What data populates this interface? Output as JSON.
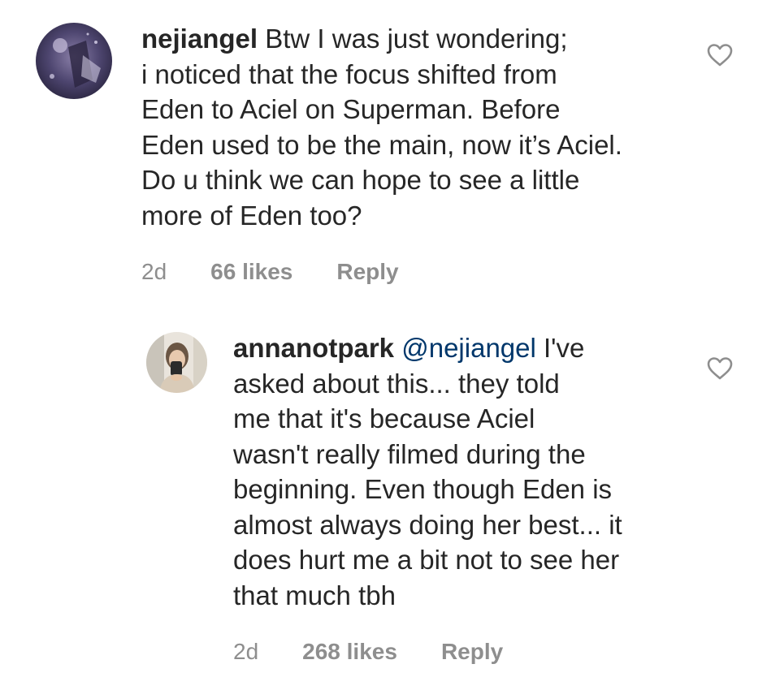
{
  "comments": [
    {
      "username": "nejiangel",
      "mention": "",
      "text_lines": [
        "Btw I was just wondering;",
        "i noticed that the focus shifted from",
        "Eden to Aciel on Superman. Before",
        "Eden used to be the main, now it’s Aciel.",
        "Do u think we can hope to see a little",
        "more of Eden too?"
      ],
      "time": "2d",
      "likes": "66 likes",
      "reply_label": "Reply",
      "like_icon": "heart-outline-icon"
    },
    {
      "username": "annanotpark",
      "mention": "@nejiangel",
      "text_lines": [
        "I've",
        "asked about this... they told",
        "me that it's because Aciel",
        "wasn't really filmed during the",
        "beginning. Even though Eden is",
        "almost always doing her best... it",
        "does hurt me a bit not to see her",
        "that much tbh"
      ],
      "time": "2d",
      "likes": "268 likes",
      "reply_label": "Reply",
      "like_icon": "heart-outline-icon"
    }
  ],
  "colors": {
    "text": "#262626",
    "meta": "#8e8e8e",
    "mention": "#00376b",
    "heart_stroke": "#8e8e8e"
  }
}
